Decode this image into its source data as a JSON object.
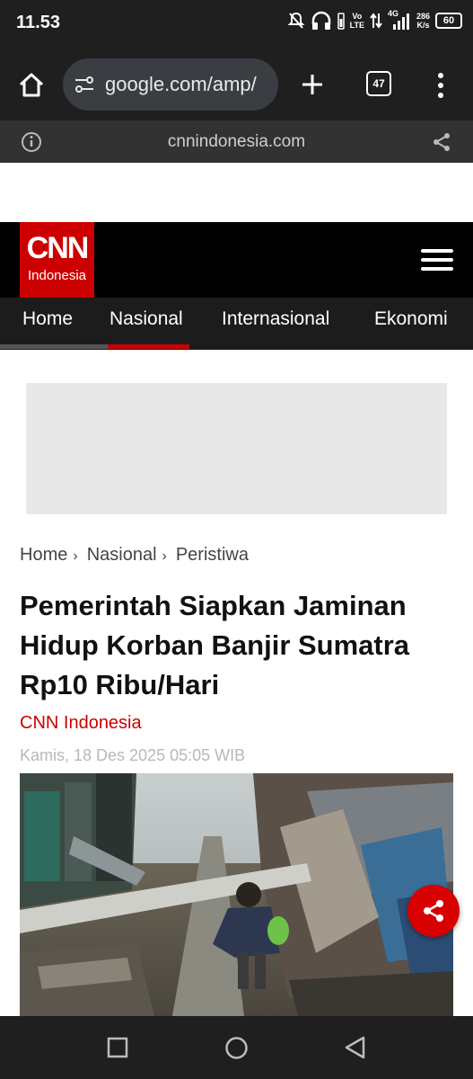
{
  "status_bar": {
    "time": "11.53",
    "volte_top": "Vo",
    "volte_bottom": "LTE",
    "network": "4G",
    "speed_value": "286",
    "speed_unit": "K/s",
    "battery": "60"
  },
  "browser": {
    "url": "google.com/amp/",
    "tab_count": "47",
    "origin": "cnnindonesia.com"
  },
  "site": {
    "logo_text": "CNN",
    "logo_sub": "Indonesia",
    "nav": [
      "Home",
      "Nasional",
      "Internasional",
      "Ekonomi"
    ],
    "active_nav": "Nasional"
  },
  "breadcrumb": [
    "Home",
    "Nasional",
    "Peristiwa"
  ],
  "article": {
    "title": "Pemerintah Siapkan Jaminan Hidup Korban Banjir Sumatra Rp10 Ribu/Hari",
    "source": "CNN Indonesia",
    "date": "Kamis, 18 Des 2025 05:05 WIB"
  },
  "colors": {
    "brand_red": "#cc0000",
    "header_black": "#000000",
    "nav_bg": "#1c1c1c",
    "browser_chrome": "#1f1f1f"
  }
}
